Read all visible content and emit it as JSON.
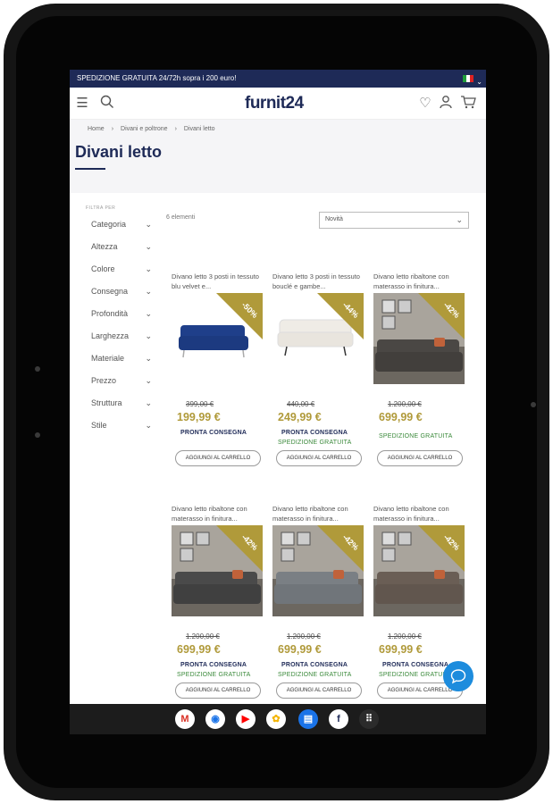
{
  "promo": {
    "text": "SPEDIZIONE GRATUITA 24/72h sopra i 200 euro!"
  },
  "header": {
    "logo": "furnit24"
  },
  "breadcrumb": [
    "Home",
    "›",
    "Divani e poltrone",
    "›",
    "Divani letto"
  ],
  "page_title": "Divani letto",
  "filters": {
    "heading": "FILTRA PER",
    "items": [
      "Categoria",
      "Altezza",
      "Colore",
      "Consegna",
      "Profondità",
      "Larghezza",
      "Materiale",
      "Prezzo",
      "Struttura",
      "Stile"
    ]
  },
  "listing": {
    "count": "6 elementi",
    "sort": "Novità"
  },
  "products": [
    {
      "name": "Divano letto 3 posti in tessuto blu velvet e...",
      "discount": "-50%",
      "old_price": "399,00 €",
      "price": "199,99 €",
      "availability": "PRONTA CONSEGNA",
      "shipping": "",
      "cart": "AGGIUNGI AL CARRELLO",
      "color": "#1f3f8a"
    },
    {
      "name": "Divano letto 3 posti in tessuto bouclé e gambe...",
      "discount": "-44%",
      "old_price": "440,00 €",
      "price": "249,99 €",
      "availability": "PRONTA CONSEGNA",
      "shipping": "SPEDIZIONE GRATUITA",
      "cart": "AGGIUNGI AL CARRELLO",
      "color": "#efece6"
    },
    {
      "name": "Divano letto ribaltone con materasso in finitura...",
      "discount": "-42%",
      "old_price": "1.200,00 €",
      "price": "699,99 €",
      "availability": "",
      "shipping": "SPEDIZIONE GRATUITA",
      "cart": "AGGIUNGI AL CARRELLO",
      "color": "#4a4744"
    },
    {
      "name": "Divano letto ribaltone con materasso in finitura...",
      "discount": "-42%",
      "old_price": "1.200,00 €",
      "price": "699,99 €",
      "availability": "PRONTA CONSEGNA",
      "shipping": "SPEDIZIONE GRATUITA",
      "cart": "AGGIUNGI AL CARRELLO",
      "color": "#4a4a4a"
    },
    {
      "name": "Divano letto ribaltone con materasso in finitura...",
      "discount": "-42%",
      "old_price": "1.200,00 €",
      "price": "699,99 €",
      "availability": "PRONTA CONSEGNA",
      "shipping": "SPEDIZIONE GRATUITA",
      "cart": "AGGIUNGI AL CARRELLO",
      "color": "#7a7f84"
    },
    {
      "name": "Divano letto ribaltone con materasso in finitura...",
      "discount": "-42%",
      "old_price": "1.200,00 €",
      "price": "699,99 €",
      "availability": "PRONTA CONSEGNA",
      "shipping": "SPEDIZIONE GRATUITA",
      "cart": "AGGIUNGI AL CARRELLO",
      "color": "#6a5e55"
    }
  ],
  "taskbar": {
    "apps": [
      {
        "icon": "gmail-icon",
        "glyph": "M",
        "color": "#d93025"
      },
      {
        "icon": "chrome-icon",
        "glyph": "◉",
        "color": "#1a73e8"
      },
      {
        "icon": "youtube-icon",
        "glyph": "▶",
        "color": "#ff0000"
      },
      {
        "icon": "photos-icon",
        "glyph": "✿",
        "color": "#f4b400"
      },
      {
        "icon": "messages-icon",
        "glyph": "▤",
        "color": "#1a73e8"
      },
      {
        "icon": "furnit24-app-icon",
        "glyph": "f",
        "color": "#1e2a57"
      },
      {
        "icon": "app-launcher-icon",
        "glyph": "⠿",
        "color": "#1a73e8"
      }
    ]
  },
  "colors": {
    "brand": "#1e2a57",
    "accent_gold": "#b09a3a",
    "shipping_green": "#3b8a3b",
    "chat_blue": "#1d8cdd"
  }
}
